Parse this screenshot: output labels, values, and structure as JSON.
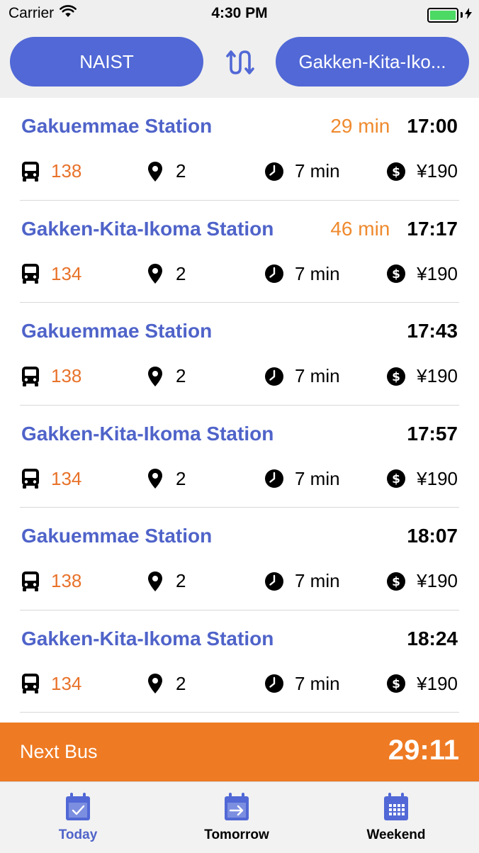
{
  "status_bar": {
    "carrier": "Carrier",
    "time": "4:30 PM"
  },
  "route": {
    "from": "NAIST",
    "to": "Gakken-Kita-Iko..."
  },
  "departures": [
    {
      "destination": "Gakuemmae Station",
      "until": "29 min",
      "time": "17:00",
      "bus": "138",
      "stops": "2",
      "duration": "7 min",
      "fare": "¥190"
    },
    {
      "destination": "Gakken-Kita-Ikoma Station",
      "until": "46 min",
      "time": "17:17",
      "bus": "134",
      "stops": "2",
      "duration": "7 min",
      "fare": "¥190"
    },
    {
      "destination": "Gakuemmae Station",
      "until": "",
      "time": "17:43",
      "bus": "138",
      "stops": "2",
      "duration": "7 min",
      "fare": "¥190"
    },
    {
      "destination": "Gakken-Kita-Ikoma Station",
      "until": "",
      "time": "17:57",
      "bus": "134",
      "stops": "2",
      "duration": "7 min",
      "fare": "¥190"
    },
    {
      "destination": "Gakuemmae Station",
      "until": "",
      "time": "18:07",
      "bus": "138",
      "stops": "2",
      "duration": "7 min",
      "fare": "¥190"
    },
    {
      "destination": "Gakken-Kita-Ikoma Station",
      "until": "",
      "time": "18:24",
      "bus": "134",
      "stops": "2",
      "duration": "7 min",
      "fare": "¥190"
    }
  ],
  "next_bus": {
    "label": "Next Bus",
    "countdown": "29:11"
  },
  "tabs": [
    {
      "label": "Today",
      "icon": "calendar-check-icon",
      "active": true
    },
    {
      "label": "Tomorrow",
      "icon": "calendar-arrow-icon",
      "active": false
    },
    {
      "label": "Weekend",
      "icon": "calendar-grid-icon",
      "active": false
    }
  ],
  "colors": {
    "accent": "#5168d6",
    "destination": "#4f63c9",
    "countdown_orange": "#ef8a2e",
    "bus_number": "#e8722a",
    "next_bus_bg": "#ee7a23"
  }
}
